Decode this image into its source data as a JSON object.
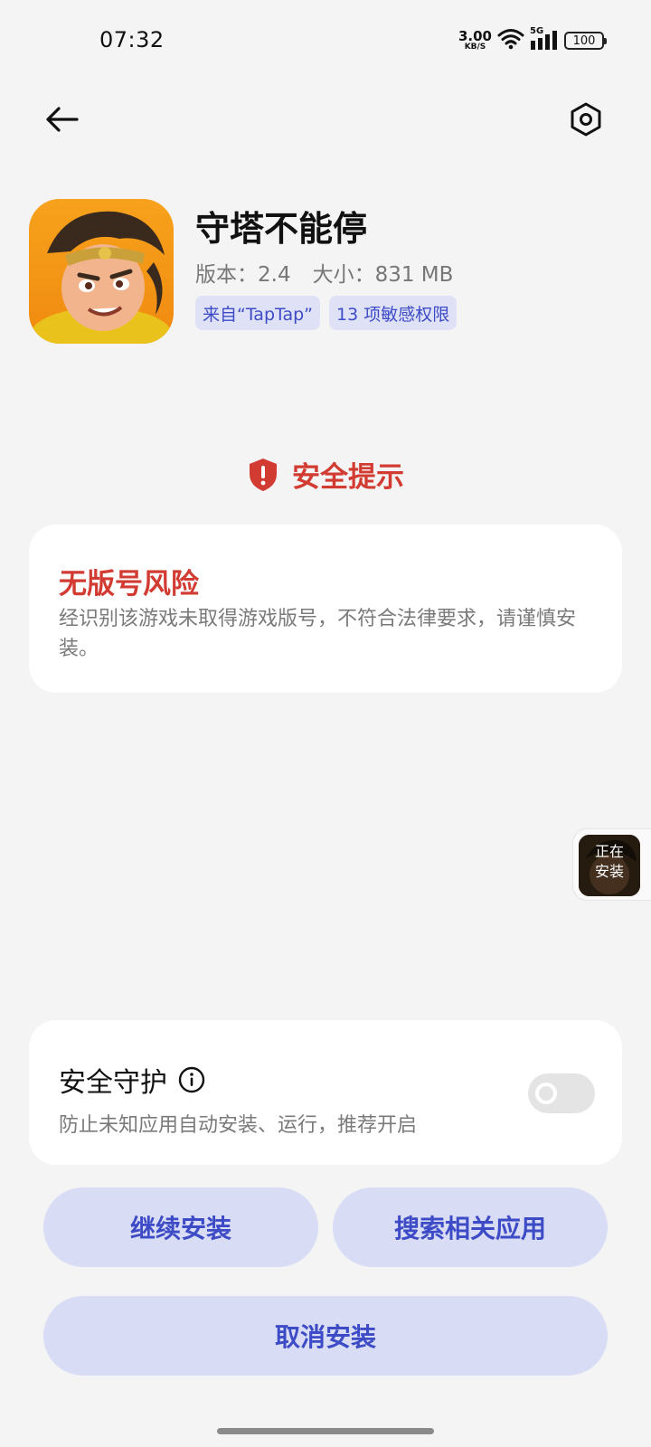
{
  "status_bar": {
    "time": "07:32",
    "net_speed_value": "3.00",
    "net_speed_unit": "KB/S",
    "network_type": "5G",
    "battery": "100"
  },
  "app": {
    "name": "守塔不能停",
    "version": "版本：2.4",
    "size": "大小：831 MB",
    "tags": [
      "来自“TapTap”",
      "13 项敏感权限"
    ]
  },
  "warning": {
    "title": "安全提示"
  },
  "risk": {
    "title": "无版号风险",
    "description": "经识别该游戏未取得游戏版号，不符合法律要求，请谨慎安装。"
  },
  "floating_badge": {
    "line1": "正在",
    "line2": "安装"
  },
  "protection": {
    "title": "安全守护",
    "description": "防止未知应用自动安装、运行，推荐开启",
    "enabled": false
  },
  "buttons": {
    "continue": "继续安装",
    "search": "搜索相关应用",
    "cancel": "取消安装"
  },
  "colors": {
    "accent": "#3d4bc6",
    "button_bg": "#d8dcf4",
    "danger": "#d23b32",
    "background": "#f4f4f4"
  },
  "icons": {
    "back": "arrow-left-icon",
    "settings": "hexagon-gear-icon",
    "warning": "shield-alert-icon",
    "info": "info-circle-icon"
  }
}
